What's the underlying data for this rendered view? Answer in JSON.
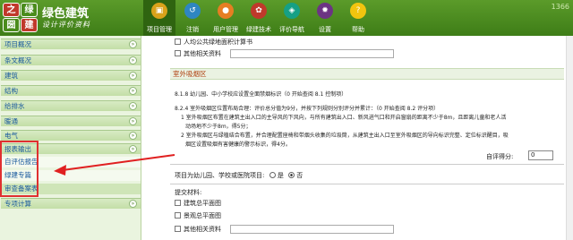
{
  "brand": {
    "name": "绿色建筑",
    "subtitle": "设计评价资料",
    "logo_chars": [
      "之",
      "绿",
      "圀",
      "建"
    ]
  },
  "version": "1366",
  "nav": [
    {
      "label": "项目管理",
      "icon": "folder-icon",
      "glyph": "▣",
      "color": "#d9a21b",
      "active": true
    },
    {
      "label": "注销",
      "icon": "logout-icon",
      "glyph": "↺",
      "color": "#2e86c1"
    },
    {
      "label": "用户管理",
      "icon": "user-icon",
      "glyph": "●",
      "color": "#e67e22"
    },
    {
      "label": "绿建技术",
      "icon": "leaf-icon",
      "glyph": "✿",
      "color": "#c0392b"
    },
    {
      "label": "评价导航",
      "icon": "map-icon",
      "glyph": "◈",
      "color": "#16a085"
    },
    {
      "label": "设置",
      "icon": "gear-icon",
      "glyph": "✹",
      "color": "#6c3483"
    },
    {
      "label": "帮助",
      "icon": "help-icon",
      "glyph": "?",
      "color": "#f1c40f"
    }
  ],
  "sidebar": {
    "headers": [
      "项目概况",
      "条文概况",
      "建筑",
      "结构",
      "给排水",
      "暖通",
      "电气",
      "报表输出"
    ],
    "report_items": [
      "自评估报告",
      "绿建专篇",
      "审查备案表"
    ],
    "last_header": "专项计算"
  },
  "main": {
    "top_rows": [
      "人均公共绿地面积计算书",
      "其他相关资料"
    ],
    "section": "室外吸烟区",
    "text": [
      "8.1.8 幼儿园、中小学校应设置全面禁烟标识（0 开始查阅    8.1 控制项）",
      "8.2.4 室外吸烟区位置布局合理：评价总分值为9分，并按下列规则分别评分并累计：（0 开始查阅    8.2 评分项）",
      "1 室外吸烟区布置在建筑主出入口的主导风的下风向，与所有建筑出入口、新风进气口和开启窗扇的距离不少于8m，且距离儿童和老人活",
      "动场地不少于8m，得5分；",
      "2 室外吸烟区与绿植结合布置，并合理配置座椅和带烟头收集的垃圾筒，从建筑主出入口至室外吸烟区的导向标识完整、定位标识醒目，吸",
      "烟区设置吸烟有害健康的警示标识，得4分。"
    ],
    "self_score_label": "自评得分:",
    "self_score_value": "0",
    "question": "项目为幼儿园、学校或医院项目:",
    "yes_label": "是",
    "no_label": "否",
    "materials_label": "提交材料:",
    "materials": [
      "建筑总平面图",
      "景观总平面图",
      "其他相关资料"
    ]
  }
}
